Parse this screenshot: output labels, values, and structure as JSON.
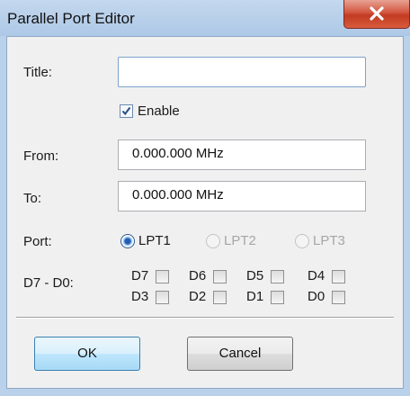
{
  "window": {
    "title": "Parallel Port Editor"
  },
  "form": {
    "title_label": "Title:",
    "title_value": "",
    "enable_label": "Enable",
    "enable_checked": true,
    "from_label": "From:",
    "from_value": "0.000.000 MHz",
    "to_label": "To:",
    "to_value": "0.000.000 MHz",
    "port_label": "Port:",
    "port_options": [
      "LPT1",
      "LPT2",
      "LPT3"
    ],
    "port_selected": "LPT1",
    "port_disabled": [
      "LPT2",
      "LPT3"
    ],
    "bits_label": "D7 - D0:",
    "bits": [
      {
        "label": "D7",
        "checked": false
      },
      {
        "label": "D6",
        "checked": false
      },
      {
        "label": "D5",
        "checked": false
      },
      {
        "label": "D4",
        "checked": false
      },
      {
        "label": "D3",
        "checked": false
      },
      {
        "label": "D2",
        "checked": false
      },
      {
        "label": "D1",
        "checked": false
      },
      {
        "label": "D0",
        "checked": false
      }
    ]
  },
  "buttons": {
    "ok_label": "OK",
    "cancel_label": "Cancel"
  },
  "icons": {
    "close": "close-icon",
    "check": "checkmark-icon"
  },
  "colors": {
    "titlebar": "#b9d1ea",
    "close_button": "#c94a32",
    "default_button": "#bee6fd",
    "radio_selected": "#1f5fb3",
    "disabled_text": "#a6a6a6"
  }
}
